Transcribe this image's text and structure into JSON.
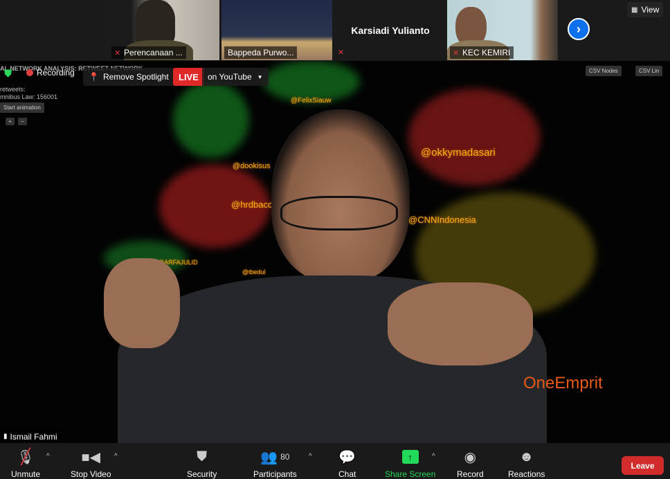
{
  "gallery": {
    "tiles": [
      {
        "name": "Perencanaan ...",
        "muted": true
      },
      {
        "name": "Bappeda Purwo...",
        "muted": false
      },
      {
        "name": "Karsiadi Yulianto",
        "muted": true,
        "video": false
      },
      {
        "name": "KEC KEMIRI",
        "muted": true
      }
    ],
    "view_label": "View"
  },
  "overlay": {
    "recording_label": "Recording",
    "remove_spotlight_label": "Remove Spotlight",
    "live_label": "LIVE",
    "live_platform": "on YouTube"
  },
  "shared_content": {
    "title": "AL NETWORK ANALYSIS: RETWEET NETWORK",
    "line1": "retweets:",
    "line2": "mnibus Law: 156001",
    "start_animation": "Start animation",
    "zoom_in": "+",
    "zoom_out": "−",
    "csv_nodes": "CSV Nodes",
    "csv_links": "CSV Lin",
    "labels": [
      "@okkymadasari",
      "@CNNIndonesia",
      "@hrdbacc",
      "@dookisus",
      "@FelixSiauw",
      "@ARFAJULID",
      "@tbedul"
    ],
    "logo": "OneEmprit"
  },
  "speaker": {
    "name": "Ismail Fahmi"
  },
  "toolbar": {
    "unmute": "Unmute",
    "stop_video": "Stop Video",
    "security": "Security",
    "participants": "Participants",
    "participants_count": "80",
    "chat": "Chat",
    "share_screen": "Share Screen",
    "record": "Record",
    "reactions": "Reactions",
    "leave": "Leave"
  },
  "colors": {
    "live": "#e02828",
    "share_screen": "#23d959",
    "leave": "#d12b2b",
    "next_button": "#0e71eb"
  }
}
